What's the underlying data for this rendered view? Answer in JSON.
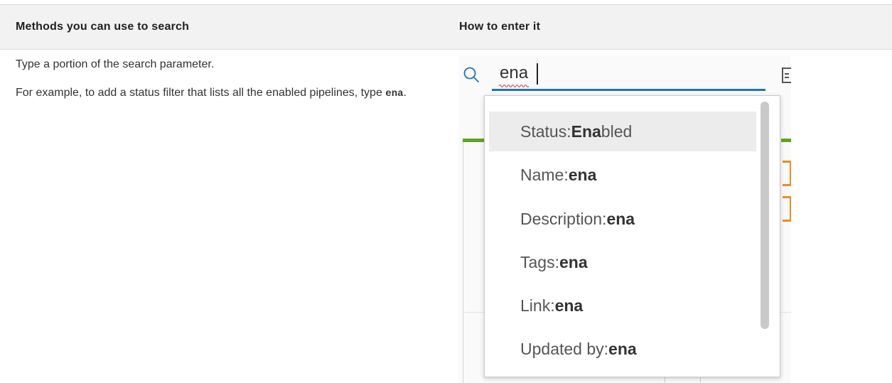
{
  "table": {
    "header": {
      "col1": "Methods you can use to search",
      "col2": "How to enter it"
    },
    "row": {
      "line1": "Type a portion of the search parameter.",
      "line2_prefix": "For example, to add a status filter that lists all the enabled pipelines, type ",
      "line2_code": "ena",
      "line2_suffix": "."
    }
  },
  "search": {
    "value": "ena",
    "icon": "search-icon"
  },
  "suggestions": [
    {
      "prefix": "Status:",
      "match": "Ena",
      "rest": "bled",
      "selected": true
    },
    {
      "prefix": "Name:",
      "match": "ena",
      "rest": "",
      "selected": false
    },
    {
      "prefix": "Description:",
      "match": "ena",
      "rest": "",
      "selected": false
    },
    {
      "prefix": "Tags:",
      "match": "ena",
      "rest": "",
      "selected": false
    },
    {
      "prefix": "Link:",
      "match": "ena",
      "rest": "",
      "selected": false
    },
    {
      "prefix": "Updated by:",
      "match": "ena",
      "rest": "",
      "selected": false
    }
  ],
  "colors": {
    "accent_blue": "#1a73c7",
    "status_green": "#62a420",
    "orange": "#f08c1a"
  }
}
